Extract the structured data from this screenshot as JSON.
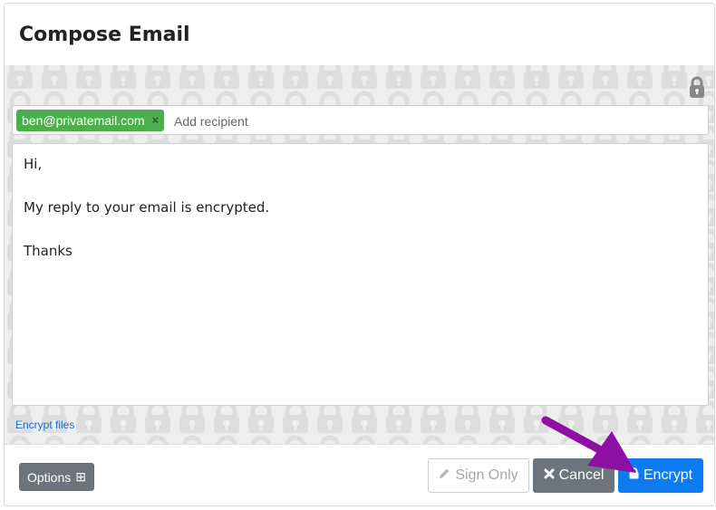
{
  "dialog": {
    "title": "Compose Email"
  },
  "icons": {
    "security_indicator": "lock-icon",
    "chip_remove": "close-icon",
    "options": "plus-square-icon",
    "sign_only": "pencil-icon",
    "cancel": "close-icon",
    "encrypt": "lock-icon",
    "background": "padlock-pattern",
    "annotation": "arrow"
  },
  "recipients": {
    "chips": [
      {
        "address": "ben@privatemail.com",
        "remove_label": "×"
      }
    ],
    "input_placeholder": "Add recipient",
    "input_value": ""
  },
  "editor": {
    "lines": [
      "Hi,",
      "",
      "My reply to your email is encrypted.",
      "",
      "Thanks"
    ]
  },
  "attachments": {
    "encrypt_files_label": "Encrypt files"
  },
  "footer": {
    "options_label": "Options",
    "options_glyph": "⊞",
    "sign_only_label": "Sign Only",
    "cancel_label": "Cancel",
    "encrypt_label": "Encrypt"
  },
  "colors": {
    "chip_green": "#4cae4c",
    "primary_blue": "#0d7cf2",
    "secondary_gray": "#6c757d",
    "annotation_purple": "#8e10a3"
  }
}
